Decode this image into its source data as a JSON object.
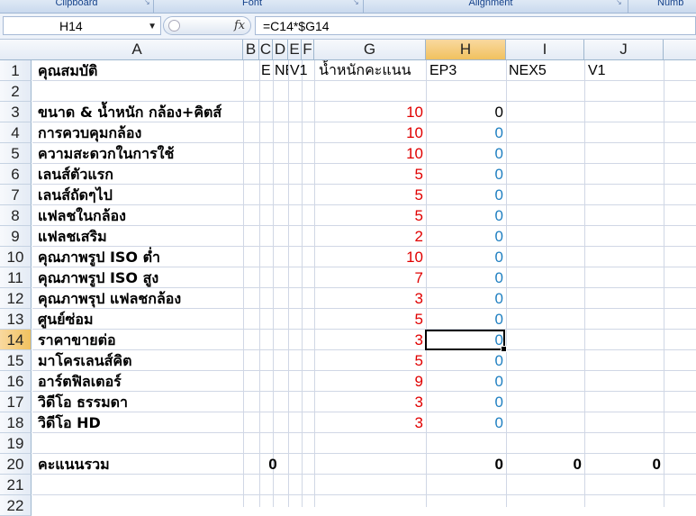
{
  "ribbon": {
    "groups": [
      "Clipboard",
      "Font",
      "Alignment",
      "Numb"
    ]
  },
  "formula_bar": {
    "name_box": "H14",
    "fx_symbol": "fx",
    "formula": "=C14*$G14"
  },
  "columns": [
    "A",
    "B",
    "C",
    "D",
    "E",
    "F",
    "G",
    "H",
    "I",
    "J"
  ],
  "rows": [
    "1",
    "2",
    "3",
    "4",
    "5",
    "6",
    "7",
    "8",
    "9",
    "10",
    "11",
    "12",
    "13",
    "14",
    "15",
    "16",
    "17",
    "18",
    "19",
    "20",
    "21",
    "22"
  ],
  "header_row": {
    "A": "คุณสมบัติ",
    "C": "E",
    "D": "NE",
    "E": "V1",
    "G": "น้ำหนักคะแนน",
    "H": "EP3",
    "I": "NEX5",
    "J": "V1"
  },
  "items": [
    {
      "row": "3",
      "label": "ขนาด & น้ำหนัก กล้อง+คิตส์",
      "weight": "10",
      "ep3": "0"
    },
    {
      "row": "4",
      "label": "การควบคุมกล้อง",
      "weight": "10",
      "ep3": "0"
    },
    {
      "row": "5",
      "label": "ความสะดวกในการใช้",
      "weight": "10",
      "ep3": "0"
    },
    {
      "row": "6",
      "label": "เลนส์ตัวแรก",
      "weight": "5",
      "ep3": "0"
    },
    {
      "row": "7",
      "label": "เลนส์ถัดๆไป",
      "weight": "5",
      "ep3": "0"
    },
    {
      "row": "8",
      "label": "แฟลชในกล้อง",
      "weight": "5",
      "ep3": "0"
    },
    {
      "row": "9",
      "label": "แฟลชเสริม",
      "weight": "2",
      "ep3": "0"
    },
    {
      "row": "10",
      "label": "คุณภาพรูป ISO ต่ำ",
      "weight": "10",
      "ep3": "0"
    },
    {
      "row": "11",
      "label": "คุณภาพรูป ISO สูง",
      "weight": "7",
      "ep3": "0"
    },
    {
      "row": "12",
      "label": "คุณภาพรุป แฟลชกล้อง",
      "weight": "3",
      "ep3": "0"
    },
    {
      "row": "13",
      "label": "ศูนย์ซ่อม",
      "weight": "5",
      "ep3": "0"
    },
    {
      "row": "14",
      "label": "ราคาขายต่อ",
      "weight": "3",
      "ep3": "0"
    },
    {
      "row": "15",
      "label": "มาโครเลนส์คิต",
      "weight": "5",
      "ep3": "0"
    },
    {
      "row": "16",
      "label": "อาร์ตฟิลเตอร์",
      "weight": "9",
      "ep3": "0"
    },
    {
      "row": "17",
      "label": "วิดีโอ ธรรมดา",
      "weight": "3",
      "ep3": "0"
    },
    {
      "row": "18",
      "label": "วิดีโอ HD",
      "weight": "3",
      "ep3": "0"
    }
  ],
  "total_row": {
    "label": "คะแนนรวม",
    "C": "0",
    "H": "0",
    "I": "0",
    "J": "0"
  },
  "colors": {
    "weight_text": "#e00000",
    "score_text": "#1f7fc1",
    "selected_header": "#f1c15f"
  }
}
